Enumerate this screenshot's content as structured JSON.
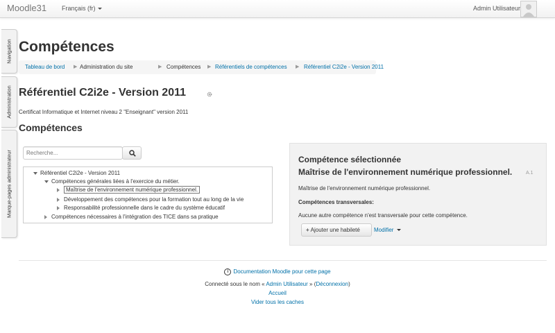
{
  "navbar": {
    "brand": "Moodle31",
    "language": "Français (fr)",
    "user_name": "Admin Utilisateur"
  },
  "side_tabs": [
    "Navigation",
    "Administration",
    "Marque-pages administrateur"
  ],
  "page_title": "Compétences",
  "breadcrumb": [
    "Tableau de bord",
    "Administration du site",
    "Compétences",
    "Référentiels de compétences",
    "Référentiel C2i2e - Version 2011"
  ],
  "framework": {
    "title": "Référentiel C2i2e - Version 2011",
    "description": "Certificat Informatique et Internet niveau 2 \"Enseignant\" version 2011"
  },
  "competencies_heading": "Compétences",
  "search": {
    "placeholder": "Recherche..."
  },
  "tree": {
    "root": "Référentiel C2i2e - Version 2011",
    "group1": "Compétences générales liées à l'exercice du métier.",
    "items": [
      "Maîtrise de l'environnement numérique professionnel.",
      "Développement des compétences pour la formation tout au long de la vie",
      "Responsabilité professionnelle dans le cadre du système éducatif"
    ],
    "group2": "Compétences nécessaires à l'intégration des TICE dans sa pratique"
  },
  "selected": {
    "heading": "Compétence sélectionnée",
    "name": "Maîtrise de l'environnement numérique professionnel.",
    "idnumber": "A.1",
    "description": "Maîtrise de l'environnement numérique professionnel.",
    "transversal_label": "Compétences transversales:",
    "transversal_text": "Aucune autre compétence n'est transversale pour cette compétence.",
    "add_button": "Ajouter une habileté",
    "edit_link": "Modifier"
  },
  "footer": {
    "doc_link": "Documentation Moodle pour cette page",
    "logged_prefix": "Connecté sous le nom «",
    "user": "Admin Utilisateur",
    "logged_mid": "» (",
    "logout": "Déconnexion",
    "logged_suffix": ")",
    "home": "Accueil",
    "purge": "Vider tous les caches"
  },
  "colors": {
    "link": "#0070a8",
    "panel_bg": "#f2f2f2"
  },
  "icons": [
    "user-avatar-icon",
    "gear-icon",
    "search-icon",
    "plus-icon",
    "info-icon"
  ]
}
